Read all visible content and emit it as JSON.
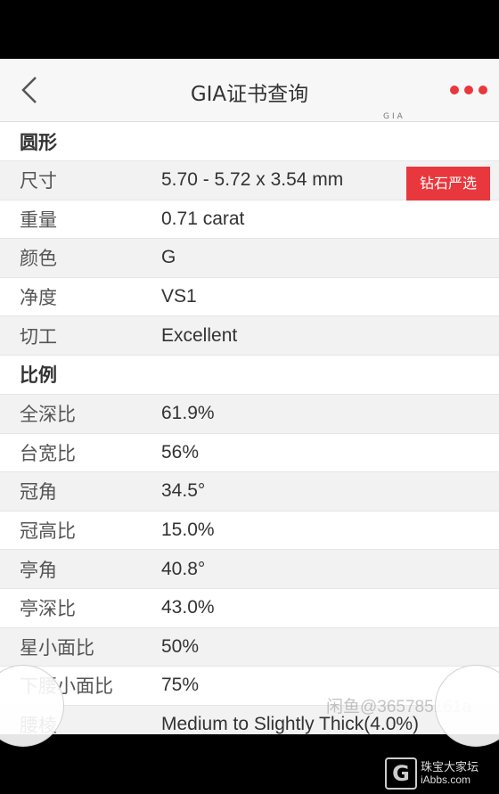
{
  "nav": {
    "title": "GIA证书查询"
  },
  "badge": {
    "label": "钻石严选"
  },
  "tiny_logo": {
    "brand": "GIA",
    "sub": "none"
  },
  "sections": {
    "shape": "圆形",
    "proportions": "比例"
  },
  "basic_rows": [
    {
      "label": "尺寸",
      "value": "5.70 - 5.72 x 3.54 mm"
    },
    {
      "label": "重量",
      "value": "0.71 carat"
    },
    {
      "label": "颜色",
      "value": "G"
    },
    {
      "label": "净度",
      "value": "VS1"
    },
    {
      "label": "切工",
      "value": "Excellent"
    }
  ],
  "proportion_rows": [
    {
      "label": "全深比",
      "value": "61.9%"
    },
    {
      "label": "台宽比",
      "value": "56%"
    },
    {
      "label": "冠角",
      "value": "34.5°"
    },
    {
      "label": "冠高比",
      "value": "15.0%"
    },
    {
      "label": "亭角",
      "value": "40.8°"
    },
    {
      "label": "亭深比",
      "value": "43.0%"
    },
    {
      "label": "星小面比",
      "value": "50%"
    },
    {
      "label": "下腰小面比",
      "value": "75%"
    },
    {
      "label": "腰棱",
      "value": "Medium to Slightly Thick(4.0%)"
    }
  ],
  "watermark": "闲鱼@365785161a",
  "forum_logo": {
    "cn": "珠宝大家坛",
    "en": "iAbbs.com"
  },
  "colors": {
    "accent": "#e8383d",
    "nav_bg": "#f7f7f7",
    "alt_row": "#f2f2f2"
  }
}
